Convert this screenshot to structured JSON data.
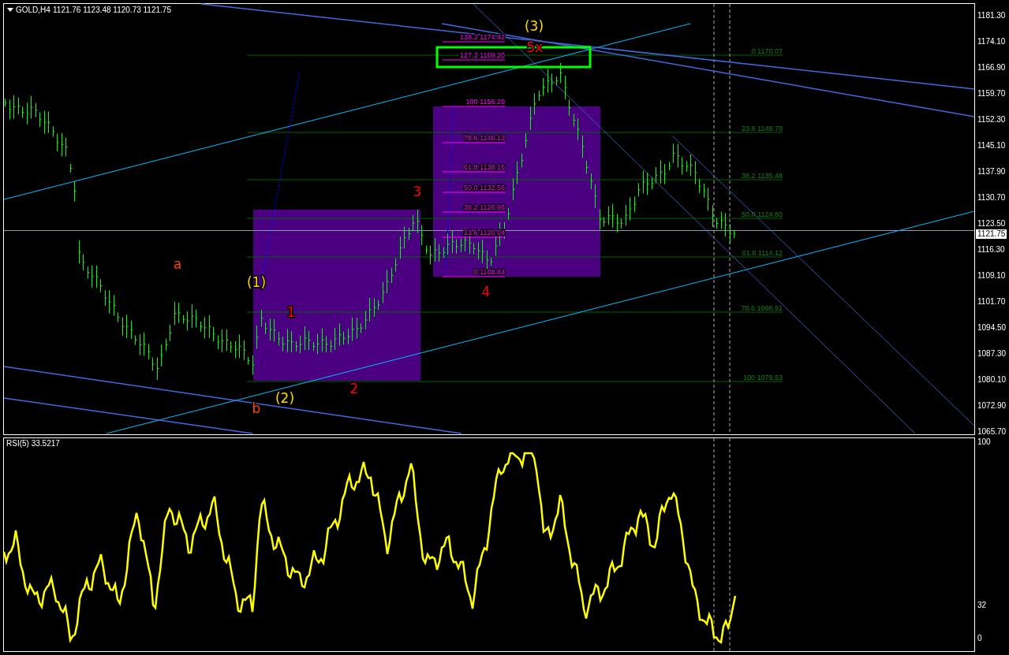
{
  "header": {
    "symbol": "GOLD,H4",
    "ohlc": "1121.76 1123.48 1120.73 1121.75"
  },
  "price_axis": {
    "ticks": [
      "1181.30",
      "1174.10",
      "1166.90",
      "1159.70",
      "1152.30",
      "1145.10",
      "1137.90",
      "1130.70",
      "1123.50",
      "1116.30",
      "1109.10",
      "1101.70",
      "1094.50",
      "1087.30",
      "1080.10",
      "1072.90",
      "1065.70"
    ],
    "current_price": "1121.75"
  },
  "fibonacci_expansion": {
    "levels": [
      {
        "label": "138.2 1174.42"
      },
      {
        "label": "127.2 1169.20"
      },
      {
        "label": "100 1156.29"
      },
      {
        "label": "78.6 1146.13"
      },
      {
        "label": "61.8 1138.16"
      },
      {
        "label": "50.0 1132.56"
      },
      {
        "label": "38.2 1126.96"
      },
      {
        "label": "23.6 1120.04"
      },
      {
        "label": "0 1108.84"
      }
    ]
  },
  "fibonacci_retracement": {
    "levels": [
      {
        "label": "0 1170.07"
      },
      {
        "label": "23.6 1148.70"
      },
      {
        "label": "38.2 1135.48"
      },
      {
        "label": "50.0 1124.80"
      },
      {
        "label": "61.8 1114.12"
      },
      {
        "label": "78.6 1098.91"
      },
      {
        "label": "100 1079.53"
      }
    ]
  },
  "wave_labels": [
    {
      "text": "a",
      "color": "#ff4500"
    },
    {
      "text": "b",
      "color": "#ff4500"
    },
    {
      "text": "(1)",
      "color": "#ffd700"
    },
    {
      "text": "(2)",
      "color": "#ffd700"
    },
    {
      "text": "(3)",
      "color": "#ffd700"
    },
    {
      "text": "1",
      "color": "#ff0000"
    },
    {
      "text": "2",
      "color": "#ff0000"
    },
    {
      "text": "3",
      "color": "#ff0000"
    },
    {
      "text": "4",
      "color": "#ff0000"
    },
    {
      "text": "5x",
      "color": "#ff0000"
    }
  ],
  "rsi_panel": {
    "title": "RSI(5) 33.5217",
    "ticks": [
      "100",
      "32",
      "0"
    ]
  }
}
